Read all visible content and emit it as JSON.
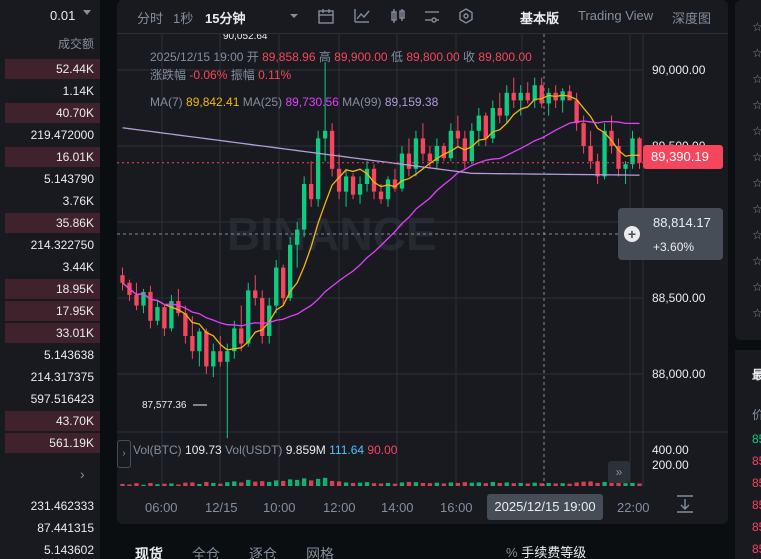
{
  "orderbook": {
    "step": "0.01",
    "column_label": "成交额",
    "rows": [
      {
        "value": "52.44K",
        "depth": 0.95
      },
      {
        "value": "1.14K",
        "depth": 0
      },
      {
        "value": "40.70K",
        "depth": 0.95
      },
      {
        "value": "219.472000",
        "depth": 0
      },
      {
        "value": "16.01K",
        "depth": 0.95
      },
      {
        "value": "5.143790",
        "depth": 0
      },
      {
        "value": "3.76K",
        "depth": 0
      },
      {
        "value": "35.86K",
        "depth": 0.95
      },
      {
        "value": "214.322750",
        "depth": 0
      },
      {
        "value": "3.44K",
        "depth": 0
      },
      {
        "value": "18.95K",
        "depth": 0.95
      },
      {
        "value": "17.95K",
        "depth": 0.95
      },
      {
        "value": "33.01K",
        "depth": 0.95
      },
      {
        "value": "5.143638",
        "depth": 0
      },
      {
        "value": "214.317375",
        "depth": 0
      },
      {
        "value": "597.516423",
        "depth": 0
      },
      {
        "value": "43.70K",
        "depth": 0.95
      },
      {
        "value": "561.19K",
        "depth": 0.95
      }
    ],
    "more_rows": [
      "231.462333",
      "87.441315",
      "5.143602"
    ]
  },
  "toolbar": {
    "intervals": [
      "分时",
      "1秒",
      "15分钟"
    ],
    "active_interval": "15分钟",
    "views": [
      "基本版",
      "Trading View",
      "深度图"
    ],
    "active_view": "基本版",
    "icons": [
      "interval-dropdown-icon",
      "calendar-icon",
      "indicator-icon",
      "candle-type-icon",
      "settings-icon",
      "hexagon-icon"
    ]
  },
  "ohlc": {
    "time": "2025/12/15 19:00",
    "open_label": "开",
    "open": "89,858.96",
    "high_label": "高",
    "high": "89,900.00",
    "low_label": "低",
    "low": "89,800.00",
    "close_label": "收",
    "close": "89,800.00",
    "change_label": "涨跌幅",
    "change": "-0.06%",
    "amplitude_label": "振幅",
    "amplitude": "0.11%"
  },
  "ma": {
    "ma7_label": "MA(7)",
    "ma7": "89,842.41",
    "ma25_label": "MA(25)",
    "ma25": "89,730.56",
    "ma99_label": "MA(99)",
    "ma99": "89,159.38"
  },
  "volume": {
    "btc_label": "Vol(BTC)",
    "btc": "109.73",
    "usdt_label": "Vol(USDT)",
    "usdt": "9.859M",
    "v1": "111.64",
    "v2": "90.00",
    "axis": [
      "400.00",
      "200.00"
    ]
  },
  "price_axis": [
    "90,000.00",
    "89,500.00",
    "89,000.00",
    "88,500.00",
    "88,000.00"
  ],
  "last_price": "89,390.19",
  "crosshair": {
    "price": "88,814.17",
    "pct": "+3.60%",
    "time": "2025/12/15 19:00"
  },
  "annotations": {
    "max": "90,052.64",
    "min": "87,577.36"
  },
  "time_axis": [
    "06:00",
    "12/15",
    "10:00",
    "12:00",
    "14:00",
    "16:00",
    "22:00"
  ],
  "watermark": "BINANCE",
  "bottom_tabs": [
    "现货",
    "全仓",
    "逐仓",
    "网格"
  ],
  "fee_label": "手续费等级",
  "right_panel": {
    "header": "最",
    "col": "价",
    "prices": [
      "85",
      "85",
      "85",
      "85",
      "85",
      "85"
    ]
  },
  "colors": {
    "up": "#0ecb81",
    "down": "#f6465d",
    "ma7": "#f0b90b",
    "ma25": "#e040fb",
    "ma99": "#b39ddb",
    "bg": "#181a20"
  },
  "chart_data": {
    "type": "candlestick",
    "interval": "15m",
    "price_range": [
      87500,
      90100
    ],
    "candles": [
      [
        88650,
        88700,
        88550,
        88600
      ],
      [
        88600,
        88620,
        88480,
        88520
      ],
      [
        88520,
        88600,
        88420,
        88450
      ],
      [
        88450,
        88560,
        88400,
        88540
      ],
      [
        88540,
        88580,
        88300,
        88350
      ],
      [
        88350,
        88480,
        88320,
        88440
      ],
      [
        88440,
        88460,
        88250,
        88300
      ],
      [
        88300,
        88520,
        88280,
        88480
      ],
      [
        88480,
        88560,
        88380,
        88400
      ],
      [
        88400,
        88450,
        88200,
        88250
      ],
      [
        88250,
        88380,
        88100,
        88150
      ],
      [
        88150,
        88300,
        88050,
        88280
      ],
      [
        88280,
        88300,
        88000,
        88050
      ],
      [
        88050,
        88200,
        87980,
        88150
      ],
      [
        88150,
        88250,
        88050,
        88080
      ],
      [
        88080,
        88200,
        87577,
        88150
      ],
      [
        88150,
        88350,
        88100,
        88300
      ],
      [
        88300,
        88450,
        88150,
        88200
      ],
      [
        88200,
        88600,
        88180,
        88550
      ],
      [
        88550,
        88650,
        88450,
        88500
      ],
      [
        88500,
        88550,
        88200,
        88250
      ],
      [
        88250,
        88500,
        88200,
        88450
      ],
      [
        88450,
        88750,
        88400,
        88700
      ],
      [
        88700,
        88720,
        88450,
        88500
      ],
      [
        88500,
        88900,
        88480,
        88850
      ],
      [
        88850,
        89000,
        88700,
        88950
      ],
      [
        88950,
        89300,
        88900,
        89250
      ],
      [
        89250,
        89400,
        89100,
        89150
      ],
      [
        89150,
        89600,
        89100,
        89550
      ],
      [
        89550,
        90052,
        89400,
        89600
      ],
      [
        89600,
        89650,
        89300,
        89350
      ],
      [
        89350,
        89450,
        89150,
        89200
      ],
      [
        89200,
        89350,
        89100,
        89300
      ],
      [
        89300,
        89320,
        89150,
        89180
      ],
      [
        89180,
        89300,
        89120,
        89250
      ],
      [
        89250,
        89400,
        89200,
        89350
      ],
      [
        89350,
        89380,
        89150,
        89200
      ],
      [
        89200,
        89250,
        89120,
        89150
      ],
      [
        89150,
        89300,
        89100,
        89280
      ],
      [
        89280,
        89350,
        89200,
        89220
      ],
      [
        89220,
        89500,
        89200,
        89450
      ],
      [
        89450,
        89550,
        89300,
        89350
      ],
      [
        89350,
        89600,
        89300,
        89550
      ],
      [
        89550,
        89650,
        89400,
        89450
      ],
      [
        89450,
        89500,
        89350,
        89400
      ],
      [
        89400,
        89550,
        89350,
        89500
      ],
      [
        89500,
        89520,
        89400,
        89420
      ],
      [
        89420,
        89650,
        89400,
        89600
      ],
      [
        89600,
        89700,
        89500,
        89550
      ],
      [
        89550,
        89600,
        89350,
        89400
      ],
      [
        89400,
        89650,
        89380,
        89600
      ],
      [
        89600,
        89750,
        89500,
        89700
      ],
      [
        89700,
        89720,
        89500,
        89550
      ],
      [
        89550,
        89800,
        89520,
        89750
      ],
      [
        89750,
        89850,
        89650,
        89700
      ],
      [
        89700,
        89900,
        89650,
        89850
      ],
      [
        89850,
        89950,
        89750,
        89800
      ],
      [
        89800,
        89900,
        89700,
        89850
      ],
      [
        89850,
        89920,
        89780,
        89800
      ],
      [
        89800,
        89950,
        89750,
        89900
      ],
      [
        89900,
        89950,
        89750,
        89780
      ],
      [
        89780,
        89880,
        89700,
        89850
      ],
      [
        89850,
        89900,
        89750,
        89800
      ],
      [
        89800,
        89880,
        89720,
        89860
      ],
      [
        89860,
        89900,
        89800,
        89800
      ],
      [
        89800,
        89850,
        89600,
        89650
      ],
      [
        89650,
        89700,
        89450,
        89500
      ],
      [
        89500,
        89600,
        89350,
        89400
      ],
      [
        89400,
        89450,
        89250,
        89300
      ],
      [
        89300,
        89650,
        89280,
        89600
      ],
      [
        89600,
        89700,
        89450,
        89500
      ],
      [
        89500,
        89550,
        89300,
        89350
      ],
      [
        89350,
        89400,
        89250,
        89380
      ],
      [
        89380,
        89600,
        89350,
        89550
      ],
      [
        89550,
        89560,
        89350,
        89390
      ]
    ],
    "volumes": [
      40,
      30,
      55,
      25,
      60,
      35,
      45,
      50,
      30,
      65,
      70,
      40,
      80,
      60,
      45,
      75,
      90,
      70,
      120,
      85,
      95,
      80,
      110,
      100,
      130,
      120,
      150,
      110,
      140,
      160,
      100,
      90,
      70,
      60,
      65,
      75,
      55,
      50,
      60,
      45,
      70,
      80,
      75,
      60,
      55,
      65,
      50,
      70,
      60,
      75,
      65,
      70,
      55,
      80,
      60,
      70,
      55,
      60,
      50,
      65,
      55,
      60,
      50,
      55,
      45,
      70,
      85,
      90,
      60,
      80,
      65,
      70,
      55,
      60,
      50
    ]
  }
}
